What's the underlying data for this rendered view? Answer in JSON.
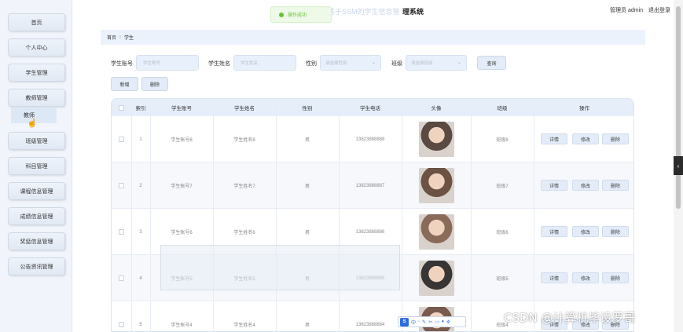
{
  "sidebar": {
    "items": [
      {
        "label": "首页"
      },
      {
        "label": "个人中心"
      },
      {
        "label": "学生管理"
      },
      {
        "label": "教师管理"
      },
      {
        "label": "班级管理"
      },
      {
        "label": "科目管理"
      },
      {
        "label": "课程信息管理"
      },
      {
        "label": "成绩信息管理"
      },
      {
        "label": "奖惩信息管理"
      },
      {
        "label": "公告资讯管理"
      }
    ],
    "submenu": {
      "label": "教师"
    }
  },
  "header": {
    "title_ghost": "基于SSM的学生信息管",
    "title": "理系统",
    "user": "管理员 admin",
    "logout": "退出登录"
  },
  "toast": {
    "message": "操作成功",
    "status_color": "#67c23a"
  },
  "breadcrumb": {
    "home": "首页",
    "current": "学生"
  },
  "search": {
    "account_label": "学生账号",
    "account_placeholder": "学生账号",
    "name_label": "学生姓名",
    "name_placeholder": "学生姓名",
    "gender_label": "性别",
    "gender_placeholder": "请选择性别",
    "class_label": "班级",
    "class_placeholder": "请选择班级",
    "query_button": "查询"
  },
  "actions": {
    "add": "新增",
    "delete": "删除"
  },
  "table": {
    "headers": {
      "index": "索引",
      "account": "学生账号",
      "name": "学生姓名",
      "gender": "性别",
      "phone": "学生电话",
      "avatar": "头像",
      "class": "班级",
      "ops": "操作"
    },
    "op_labels": {
      "detail": "详情",
      "edit": "修改",
      "delete": "删除"
    },
    "rows": [
      {
        "index": "1",
        "account": "学生账号8",
        "name": "学生姓名8",
        "gender": "男",
        "phone": "13823888888",
        "class": "班级8",
        "avatar_color": "#5a4a42"
      },
      {
        "index": "2",
        "account": "学生账号7",
        "name": "学生姓名7",
        "gender": "男",
        "phone": "13823888887",
        "class": "班级7",
        "avatar_color": "#6b5243"
      },
      {
        "index": "3",
        "account": "学生账号6",
        "name": "学生姓名6",
        "gender": "男",
        "phone": "13823888886",
        "class": "班级6",
        "avatar_color": "#8a6a58"
      },
      {
        "index": "4",
        "account": "学生账号5",
        "name": "学生姓名5",
        "gender": "男",
        "phone": "13823888885",
        "class": "班级5",
        "avatar_color": "#3a3535"
      },
      {
        "index": "5",
        "account": "学生账号4",
        "name": "学生姓名4",
        "gender": "男",
        "phone": "13823888884",
        "class": "班级4",
        "avatar_color": "#7a5a4c"
      }
    ]
  },
  "watermark": "CSDN @计算机毕设罗哥",
  "ime": {
    "logo": "S",
    "mode": "中"
  }
}
